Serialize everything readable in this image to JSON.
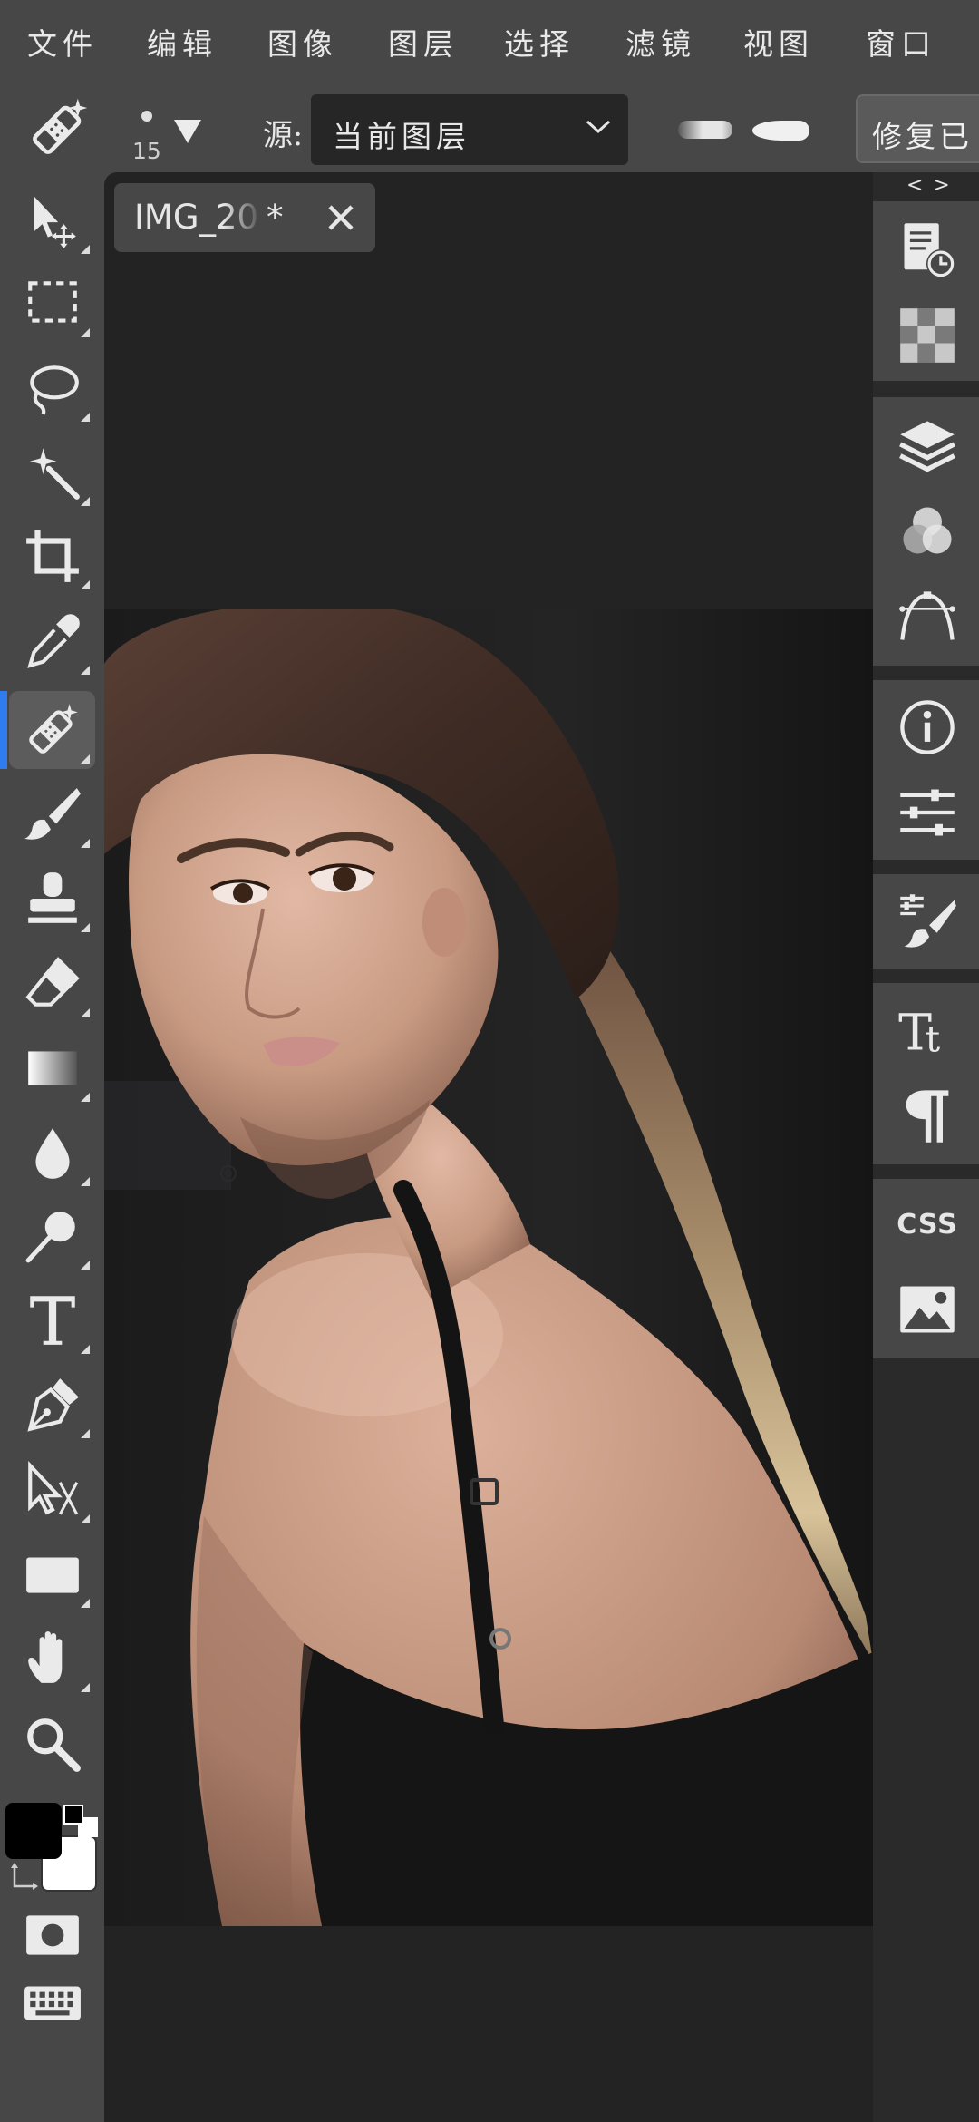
{
  "menu": {
    "items": [
      "文件",
      "编辑",
      "图像",
      "图层",
      "选择",
      "滤镜",
      "视图",
      "窗口"
    ]
  },
  "options": {
    "brush_size": "15",
    "source_label": "源:",
    "source_value": "当前图层",
    "repair_button": "修复已"
  },
  "document": {
    "tab_name": "IMG_20",
    "modified_mark": "*"
  },
  "panel": {
    "collapse_label": "< >",
    "css_label": "CSS"
  },
  "colors": {
    "accent": "#2f7cf0",
    "foreground": "#000000",
    "background": "#ffffff"
  }
}
